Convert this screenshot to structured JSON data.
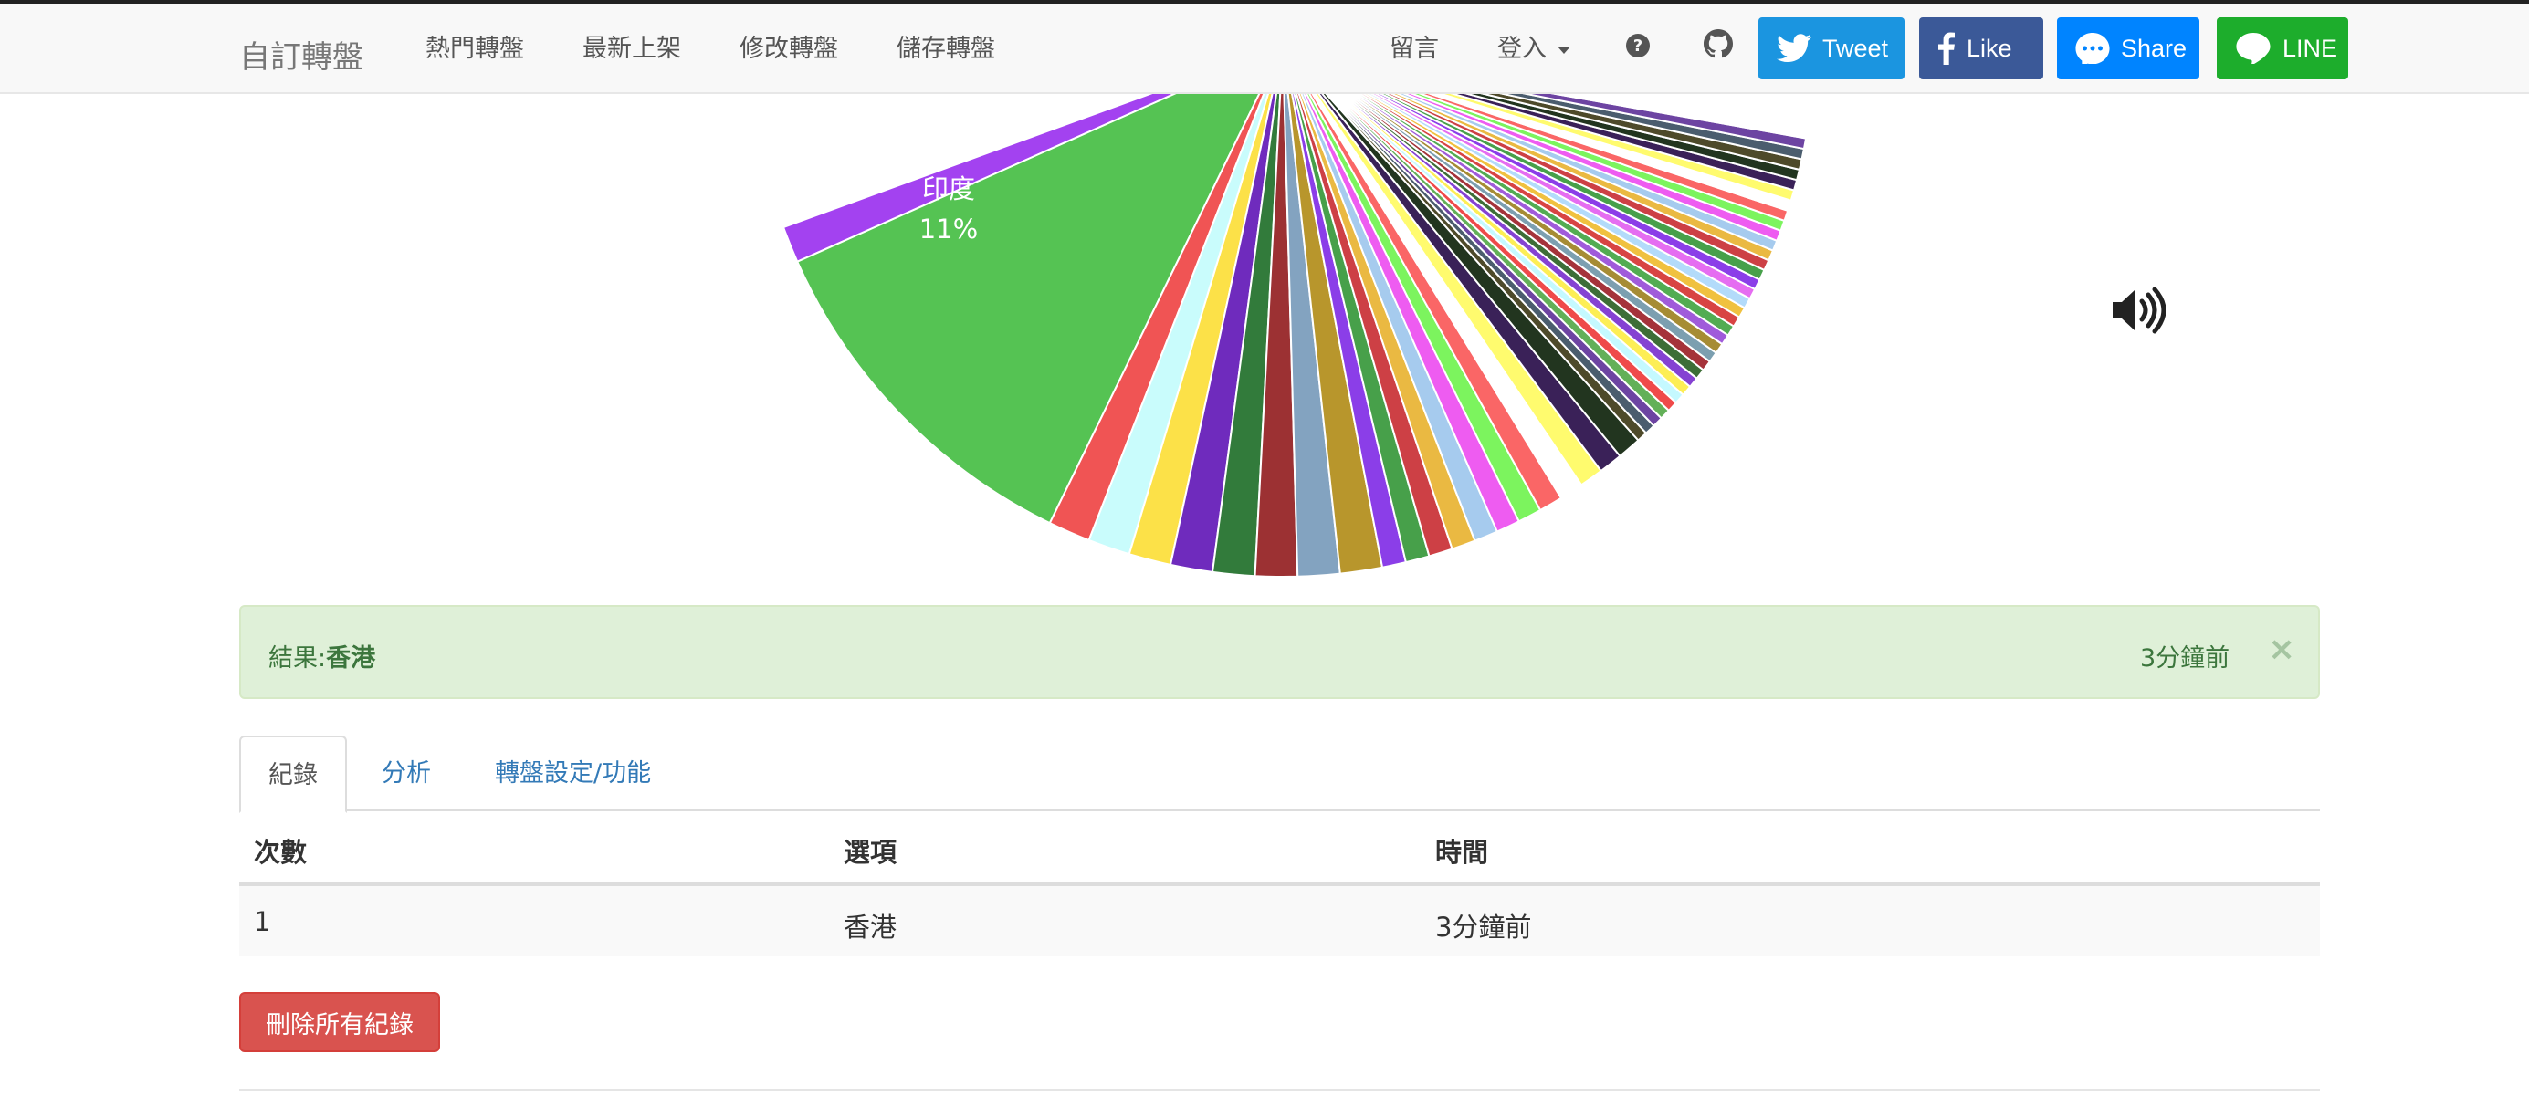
{
  "navbar": {
    "brand": "自訂轉盤",
    "links": [
      "熱門轉盤",
      "最新上架",
      "修改轉盤",
      "儲存轉盤"
    ],
    "comment": "留言",
    "login": "登入",
    "help_icon": "question-circle-icon",
    "github_icon": "github-icon",
    "social": [
      {
        "label": "Tweet",
        "icon": "twitter-icon",
        "color": "#1b95e0"
      },
      {
        "label": "Like",
        "icon": "facebook-icon",
        "color": "#3b5998"
      },
      {
        "label": "Share",
        "icon": "messenger-icon",
        "color": "#0084ff"
      },
      {
        "label": "LINE",
        "icon": "line-icon",
        "color": "#1dad2c"
      }
    ]
  },
  "wheel": {
    "visible_label": "印度",
    "visible_percent": "11%",
    "sound_icon": "volume-up-icon"
  },
  "result": {
    "prefix": "結果:",
    "value": "香港",
    "time": "3分鐘前",
    "close": "×"
  },
  "tabs": [
    {
      "label": "紀錄",
      "active": true
    },
    {
      "label": "分析",
      "active": false
    },
    {
      "label": "轉盤設定/功能",
      "active": false
    }
  ],
  "table": {
    "headers": [
      "次數",
      "選項",
      "時間"
    ],
    "rows": [
      {
        "count": "1",
        "option": "香港",
        "time": "3分鐘前"
      }
    ]
  },
  "delete_all": "刪除所有紀錄",
  "colors": {
    "navbar_bg": "#f8f8f8",
    "link": "#337ab7",
    "success_bg": "#dff0d8",
    "success_text": "#3c763d",
    "danger": "#d9534f"
  }
}
